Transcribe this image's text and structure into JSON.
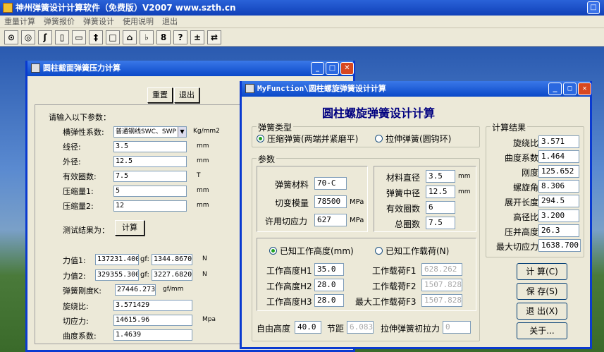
{
  "app": {
    "title": "神州弹簧设计计算软件（免费版）V2007   www.szth.cn",
    "menu": [
      "重量计算",
      "弹簧报价",
      "弹簧设计",
      "使用说明",
      "退出"
    ],
    "toolbar_icons": [
      "coil-circle-icon",
      "ring-icon",
      "spring-s-icon",
      "bar-icon",
      "flat-bar-icon",
      "torsion-icon",
      "frame-icon",
      "arch-icon",
      "wire-icon",
      "chain-icon",
      "help-icon",
      "plus-minus-icon",
      "swap-icon"
    ],
    "toolbar_glyphs": [
      "⊙",
      "◎",
      "ʃ",
      "▯",
      "▭",
      "‡",
      "□",
      "⌂",
      "♭",
      "8",
      "?",
      "±",
      "⇄"
    ]
  },
  "win1": {
    "title": "圆柱截面弹簧压力计算",
    "reset_label": "重置",
    "exit_label": "退出",
    "prompt": "请输入以下参数：",
    "fields": [
      {
        "label": "横弹性系数:",
        "value": "普通钢线SWC、SWP",
        "unit": "Kg/mm2",
        "select": true
      },
      {
        "label": "线径:",
        "value": "3.5",
        "unit": "mm"
      },
      {
        "label": "外径:",
        "value": "12.5",
        "unit": "mm"
      },
      {
        "label": "有效圈数:",
        "value": "7.5",
        "unit": "T"
      },
      {
        "label": "压缩量1:",
        "value": "5",
        "unit": "mm"
      },
      {
        "label": "压缩量2:",
        "value": "12",
        "unit": "mm"
      }
    ],
    "test_label": "测试结果为：",
    "calc_label": "计算",
    "force1": {
      "label": "力值1:",
      "n": "137231.400",
      "gf": "gf:",
      "kg": "1344.8670",
      "unit": "N"
    },
    "force2": {
      "label": "力值2:",
      "n": "329355.300",
      "gf": "gf:",
      "kg": "3227.6820",
      "unit": "N"
    },
    "results": [
      {
        "label": "弹簧刚度K:",
        "value": "27446.2734",
        "unit": "gf/mm"
      },
      {
        "label": "旋绕比:",
        "value": "3.571429",
        "unit": ""
      },
      {
        "label": "切应力:",
        "value": "14615.96",
        "unit": "Mpa"
      },
      {
        "label": "曲度系数:",
        "value": "1.4639",
        "unit": ""
      }
    ]
  },
  "win2": {
    "title": "MyFunction\\圆柱螺旋弹簧设计计算",
    "heading": "圆柱螺旋弹簧设计计算",
    "type_group": "弹簧类型",
    "type_opts": [
      "压缩弹簧(两端并紧磨平)",
      "拉伸弹簧(圆钩环)"
    ],
    "param_group": "参数",
    "material_label": "弹簧材料",
    "material_value": "70-C",
    "shear_mod_label": "切变模量",
    "shear_mod_value": "78500",
    "shear_mod_unit": "MPa",
    "allow_label": "许用切应力",
    "allow_value": "627",
    "allow_unit": "MPa",
    "wire_d_label": "材料直径",
    "wire_d_value": "3.5",
    "wire_d_unit": "mm",
    "mean_d_label": "弹簧中径",
    "mean_d_value": "12.5",
    "mean_d_unit": "mm",
    "active_label": "有效圈数",
    "active_value": "6",
    "total_label": "总圈数",
    "total_value": "7.5",
    "mode_opts": [
      "已知工作高度(mm)",
      "已知工作载荷(N)"
    ],
    "h1_label": "工作高度H1",
    "h1_value": "35.0",
    "h2_label": "工作高度H2",
    "h2_value": "28.0",
    "h3_label": "工作高度H3",
    "h3_value": "28.0",
    "f1_label": "工作载荷F1",
    "f1_value": "628.262",
    "f2_label": "工作载荷F2",
    "f2_value": "1507.828",
    "f3_label": "最大工作载荷F3",
    "f3_value": "1507.828",
    "free_label": "自由高度",
    "free_value": "40.0",
    "pitch_label": "节距",
    "pitch_value": "6.083",
    "init_label": "拉伸弹簧初拉力",
    "init_value": "0",
    "result_group": "计算结果",
    "results": [
      {
        "label": "旋绕比",
        "value": "3.571"
      },
      {
        "label": "曲度系数",
        "value": "1.464"
      },
      {
        "label": "刚度",
        "value": "125.652"
      },
      {
        "label": "螺旋角",
        "value": "8.306"
      },
      {
        "label": "展开长度",
        "value": "294.5"
      },
      {
        "label": "高径比",
        "value": "3.200"
      },
      {
        "label": "压并高度",
        "value": "26.3"
      },
      {
        "label": "最大切应力",
        "value": "1638.700"
      }
    ],
    "calc_btn": "计 算(C)",
    "save_btn": "保 存(S)",
    "exit_btn": "退 出(X)",
    "about_btn": "关于..."
  }
}
